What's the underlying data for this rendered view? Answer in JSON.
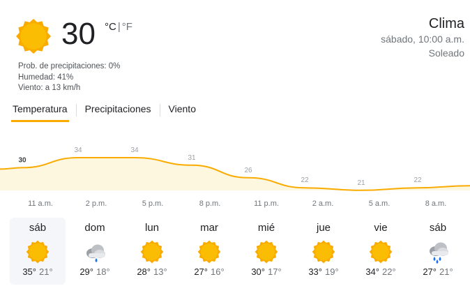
{
  "current": {
    "temp": "30",
    "unit_c": "°C",
    "unit_sep": "|",
    "unit_f": "°F",
    "icon": "sun-icon",
    "details": [
      "Prob. de precipitaciones: 0%",
      "Humedad: 41%",
      "Viento: a 13 km/h"
    ]
  },
  "header": {
    "title": "Clima",
    "datetime": "sábado, 10:00 a.m.",
    "condition": "Soleado"
  },
  "tabs": [
    {
      "label": "Temperatura",
      "active": true
    },
    {
      "label": "Precipitaciones",
      "active": false
    },
    {
      "label": "Viento",
      "active": false
    }
  ],
  "hourly": {
    "temps": [
      "30",
      "34",
      "34",
      "31",
      "26",
      "22",
      "21",
      "22"
    ],
    "hours": [
      "11 a.m.",
      "2 p.m.",
      "5 p.m.",
      "8 p.m.",
      "11 p.m.",
      "2 a.m.",
      "5 a.m.",
      "8 a.m."
    ],
    "accent": "#f9ab00",
    "fill": "#fef7e0"
  },
  "days": [
    {
      "name": "sáb",
      "hi": "35°",
      "lo": "21°",
      "icon": "sun-icon",
      "selected": true
    },
    {
      "name": "dom",
      "hi": "29°",
      "lo": "18°",
      "icon": "cloud-rain-icon",
      "selected": false
    },
    {
      "name": "lun",
      "hi": "28°",
      "lo": "13°",
      "icon": "sun-icon",
      "selected": false
    },
    {
      "name": "mar",
      "hi": "27°",
      "lo": "16°",
      "icon": "sun-icon",
      "selected": false
    },
    {
      "name": "mié",
      "hi": "30°",
      "lo": "17°",
      "icon": "sun-icon",
      "selected": false
    },
    {
      "name": "jue",
      "hi": "33°",
      "lo": "19°",
      "icon": "sun-icon",
      "selected": false
    },
    {
      "name": "vie",
      "hi": "34°",
      "lo": "22°",
      "icon": "sun-icon",
      "selected": false
    },
    {
      "name": "sáb",
      "hi": "27°",
      "lo": "21°",
      "icon": "storm-rain-icon",
      "selected": false
    }
  ]
}
